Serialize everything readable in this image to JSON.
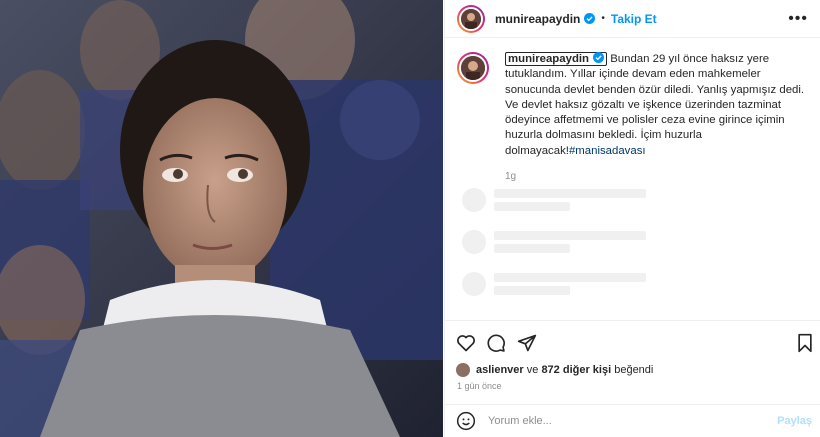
{
  "post": {
    "username": "munireapaydin",
    "follow_label": "Takip Et",
    "dot": "•",
    "more_icon": "•••",
    "caption_text": "Bundan 29 yıl önce haksız yere tutuklandım. Yıllar içinde devam eden mahkemeler sonucunda devlet benden özür diledi. Yanlış yapmışız dedi. Ve devlet haksız gözaltı ve işkence üzerinden tazminat ödeyince affetmemi ve polisler ceza evine girince içimin huzurla dolmasını bekledi. İçim huzurla dolmayacak!",
    "hashtag": "#manisadavası",
    "caption_age": "1g"
  },
  "likes": {
    "first_user": "aslienver",
    "connector": " ve ",
    "others": "872 diğer kişi",
    "suffix": " beğendi"
  },
  "posted_ago": "1 gün önce",
  "comment": {
    "placeholder": "Yorum ekle...",
    "share_label": "Paylaş"
  },
  "icons": {
    "verified": "verified-badge-icon",
    "like": "heart-icon",
    "comment": "comment-icon",
    "share": "send-icon",
    "save": "bookmark-icon",
    "emoji": "smiley-icon"
  },
  "colors": {
    "link_blue": "#0095f6",
    "hashtag_blue": "#00376b",
    "text": "#262626",
    "muted": "#8e8e8e"
  }
}
